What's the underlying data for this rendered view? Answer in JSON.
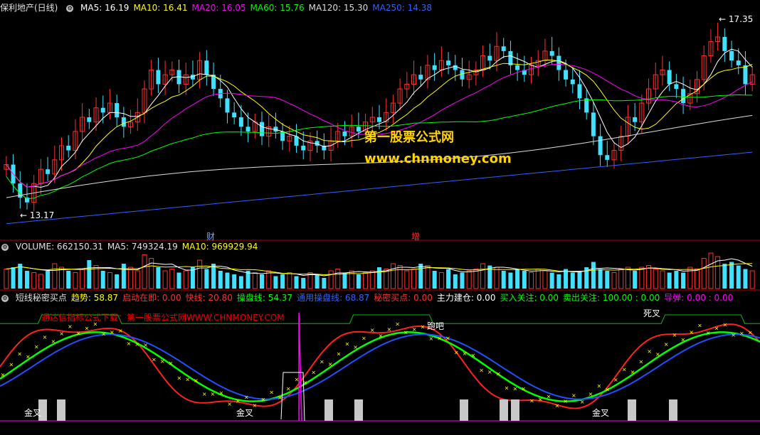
{
  "chart_data": {
    "type": "candlestick",
    "stock_name": "保利地产(日线)",
    "ma_legend": [
      {
        "label": "MA5: 16.19",
        "color": "#ffffff"
      },
      {
        "label": "MA10: 16.41",
        "color": "#ffff00"
      },
      {
        "label": "MA20: 16.05",
        "color": "#ff00ff"
      },
      {
        "label": "MA60: 15.76",
        "color": "#00ff00"
      },
      {
        "label": "MA120: 15.30",
        "color": "#dddddd"
      },
      {
        "label": "MA250: 14.38",
        "color": "#3060ff"
      }
    ],
    "price_high_label": "17.35",
    "price_low_label": "13.17",
    "ylim": [
      13.0,
      17.45
    ],
    "closes": [
      14.3,
      13.9,
      13.6,
      13.5,
      13.9,
      14.2,
      14.1,
      14.4,
      14.7,
      14.6,
      15.0,
      15.3,
      15.2,
      15.5,
      15.4,
      15.6,
      15.3,
      15.1,
      15.2,
      15.4,
      15.9,
      16.3,
      16.0,
      16.2,
      16.3,
      16.0,
      16.2,
      16.1,
      16.5,
      16.2,
      15.9,
      15.7,
      15.4,
      15.3,
      15.1,
      15.0,
      15.2,
      14.9,
      15.1,
      15.0,
      14.8,
      14.9,
      14.7,
      14.6,
      14.8,
      14.7,
      14.6,
      14.8,
      15.0,
      14.9,
      15.1,
      15.0,
      15.2,
      15.3,
      15.2,
      15.4,
      15.6,
      15.9,
      16.0,
      16.2,
      16.1,
      16.4,
      16.3,
      16.5,
      16.4,
      16.3,
      16.1,
      16.2,
      16.3,
      16.6,
      16.5,
      16.8,
      16.7,
      16.4,
      16.3,
      16.2,
      16.4,
      16.5,
      16.7,
      16.6,
      16.3,
      16.1,
      16.0,
      15.7,
      15.4,
      14.9,
      14.5,
      14.4,
      14.6,
      14.9,
      15.3,
      15.2,
      15.6,
      15.9,
      16.2,
      16.3,
      16.0,
      15.9,
      15.6,
      15.8,
      16.1,
      16.6,
      16.9,
      17.0,
      16.7,
      16.5,
      16.4,
      16.0,
      16.2
    ],
    "volume_legend": [
      {
        "label": "VOLUME: 662150.31",
        "color": "#e0e0e0"
      },
      {
        "label": "MA5: 749324.19",
        "color": "#e0e0e0"
      },
      {
        "label": "MA10: 969929.94",
        "color": "#ffff00"
      }
    ],
    "volumes": [
      0.55,
      0.6,
      0.7,
      0.5,
      0.45,
      0.4,
      0.5,
      0.7,
      0.6,
      0.5,
      0.45,
      0.55,
      0.8,
      0.65,
      0.5,
      0.45,
      0.4,
      0.7,
      0.6,
      0.5,
      0.95,
      0.85,
      0.6,
      0.5,
      0.55,
      0.45,
      0.5,
      0.6,
      0.8,
      0.55,
      0.7,
      0.5,
      0.45,
      0.4,
      0.35,
      0.5,
      0.45,
      0.4,
      0.5,
      0.35,
      0.4,
      0.45,
      0.35,
      0.3,
      0.45,
      0.4,
      0.3,
      0.5,
      0.55,
      0.45,
      0.5,
      0.4,
      0.45,
      0.5,
      0.6,
      0.55,
      0.7,
      0.65,
      0.5,
      0.55,
      0.7,
      0.65,
      0.5,
      0.45,
      0.55,
      0.4,
      0.45,
      0.5,
      0.55,
      0.7,
      0.65,
      0.6,
      0.5,
      0.45,
      0.55,
      0.5,
      0.45,
      0.55,
      0.5,
      0.45,
      0.4,
      0.55,
      0.45,
      0.5,
      0.6,
      0.75,
      0.55,
      0.5,
      0.45,
      0.55,
      0.6,
      0.5,
      0.6,
      0.65,
      0.55,
      0.5,
      0.45,
      0.5,
      0.45,
      0.6,
      0.55,
      0.85,
      1.0,
      0.9,
      0.7,
      0.75,
      0.65,
      0.55,
      0.5
    ]
  },
  "indicator_header": [
    {
      "label": "短线秘密买点",
      "color": "#e0e0e0"
    },
    {
      "label": "趋势: 58.87",
      "color": "#ffff00"
    },
    {
      "label": "启动在即: 0.00",
      "color": "#ff3030"
    },
    {
      "label": "快线: 20.80",
      "color": "#ff3030"
    },
    {
      "label": "操盘线: 54.37",
      "color": "#00ff00"
    },
    {
      "label": "通用操盘线: 68.87",
      "color": "#3060ff"
    },
    {
      "label": "秘密买点: 0.00",
      "color": "#ff3030"
    },
    {
      "label": "主力建仓: 0.00",
      "color": "#ffffff"
    },
    {
      "label": "买入关注: 0.00",
      "color": "#00ff00"
    },
    {
      "label": "卖出关注: 100.00 : 0.00",
      "color": "#00ff00"
    },
    {
      "label": "导弹: 0.00 : 0.00",
      "color": "#ff00ff"
    }
  ],
  "markers": {
    "cai": "财",
    "zeng": "增",
    "jin_cha": "金叉",
    "si_cha": "死叉",
    "pao_ba": "跑吧"
  },
  "watermark": {
    "line1": "第一股票公式网",
    "line2": "www.chnmoney.com",
    "note": "通达信指标公式下载：第一股票公式网WWW.CHNMONEY.COM"
  },
  "colors": {
    "up": "#ff3030",
    "down": "#40e0ff",
    "ma5": "#ffffff",
    "ma10": "#ffff00",
    "ma20": "#ff00ff",
    "ma60": "#00ff00",
    "ma120": "#dddddd",
    "ma250": "#3060ff",
    "divider": "#b00000"
  }
}
